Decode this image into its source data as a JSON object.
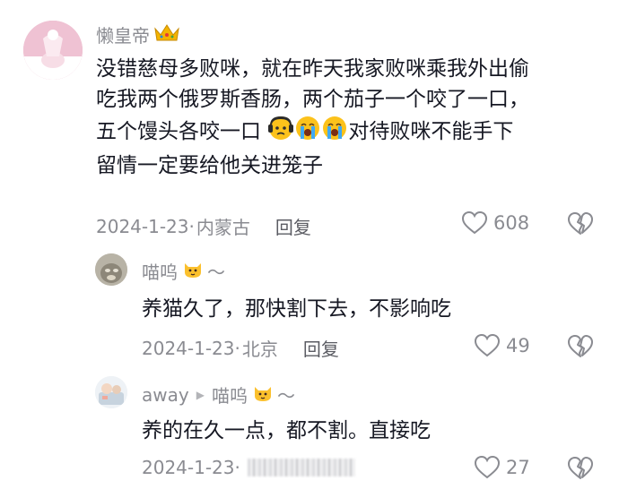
{
  "comments": [
    {
      "author": "懒皇帝",
      "author_badge_icon": "crown-emoji",
      "text_lines": [
        "没错慈母多败咪，就在昨天我家败咪乘我外出偷",
        "吃我两个俄罗斯香肠，两个茄子一个咬了一口，",
        "五个馒头各咬一口",
        "对待败咪不能手下",
        "留情一定要给他关进笼子"
      ],
      "inline_emojis": [
        "worried-face-emoji",
        "loudly-crying-face-emoji",
        "loudly-crying-face-emoji"
      ],
      "date": "2024-1-23",
      "separator": "·",
      "location": "内蒙古",
      "reply_label": "回复",
      "likes": "608"
    }
  ],
  "replies": [
    {
      "author": "喵呜",
      "author_emoji": "cat-face-emoji",
      "author_suffix": "～",
      "text": "养猫久了，那快割下去，不影响吃",
      "date": "2024-1-23",
      "separator": "·",
      "location": "北京",
      "reply_label": "回复",
      "likes": "49"
    },
    {
      "author": "away",
      "reply_to": "喵呜",
      "reply_to_emoji": "cat-face-emoji",
      "reply_to_suffix": "～",
      "text": "养的在久一点，都不割。直接吃",
      "date": "2024-1-23",
      "separator": "·",
      "likes": "27"
    }
  ],
  "colors": {
    "text": "#161823",
    "meta": "#8a8b91",
    "background": "#ffffff"
  }
}
